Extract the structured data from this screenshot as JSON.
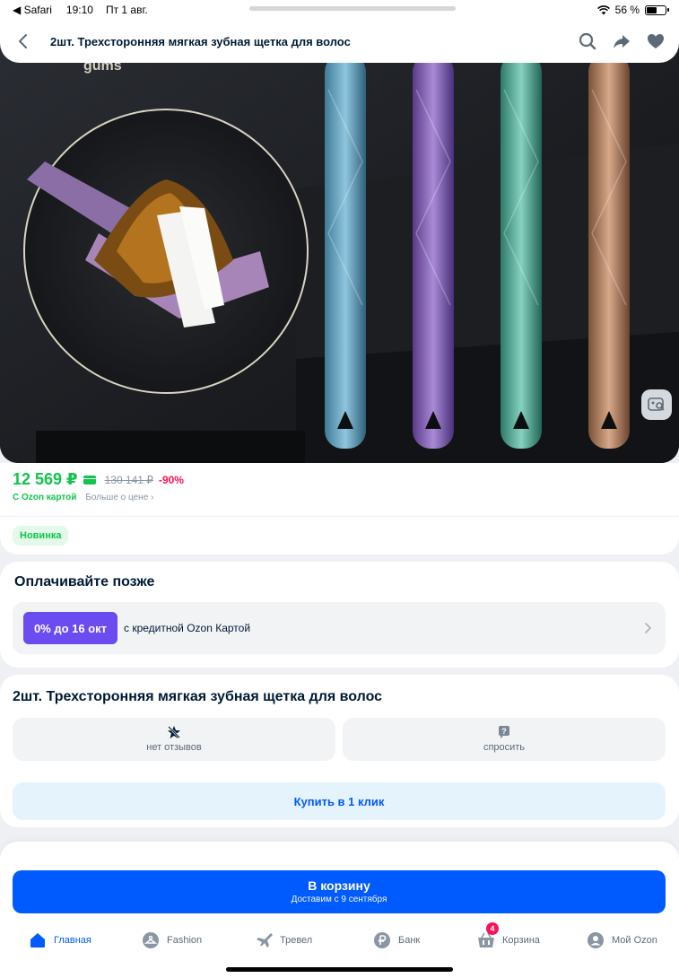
{
  "statusbar": {
    "back_app": "◀ Safari",
    "time": "19:10",
    "date": "Пт 1 авг.",
    "battery_percent": "56 %",
    "battery_level": 0.56
  },
  "header": {
    "title": "2шт. Трехсторонняя мягкая зубная щетка для волос"
  },
  "hero": {
    "overlay_text": "gums"
  },
  "price": {
    "current": "12 569 ₽",
    "old": "130 141 ₽",
    "discount": "-90%",
    "ozon_card": "С Ozon картой",
    "more": "Больше о цене ›",
    "badge": "Новинка"
  },
  "pay_later": {
    "title": "Оплачивайте позже",
    "chip": "0% до 16 окт",
    "text": "с кредитной Ozon Картой"
  },
  "product": {
    "title": "2шт. Трехсторонняя мягкая зубная щетка для волос",
    "reviews": "нет отзывов",
    "ask": "спросить",
    "buy_one_click": "Купить в 1 клик"
  },
  "cart": {
    "button": "В корзину",
    "delivery": "Доставим с 9 сентября"
  },
  "tabs": [
    {
      "label": "Главная",
      "icon": "home-icon"
    },
    {
      "label": "Fashion",
      "icon": "hanger-icon"
    },
    {
      "label": "Тревел",
      "icon": "plane-icon"
    },
    {
      "label": "Банк",
      "icon": "ruble-icon"
    },
    {
      "label": "Корзина",
      "icon": "basket-icon",
      "badge": "4"
    },
    {
      "label": "Мой Ozon",
      "icon": "profile-icon"
    }
  ],
  "colors": {
    "accent": "#005bff",
    "price_green": "#10c44c",
    "discount_pink": "#f91155",
    "chip_purple": "#6a4cf0"
  }
}
